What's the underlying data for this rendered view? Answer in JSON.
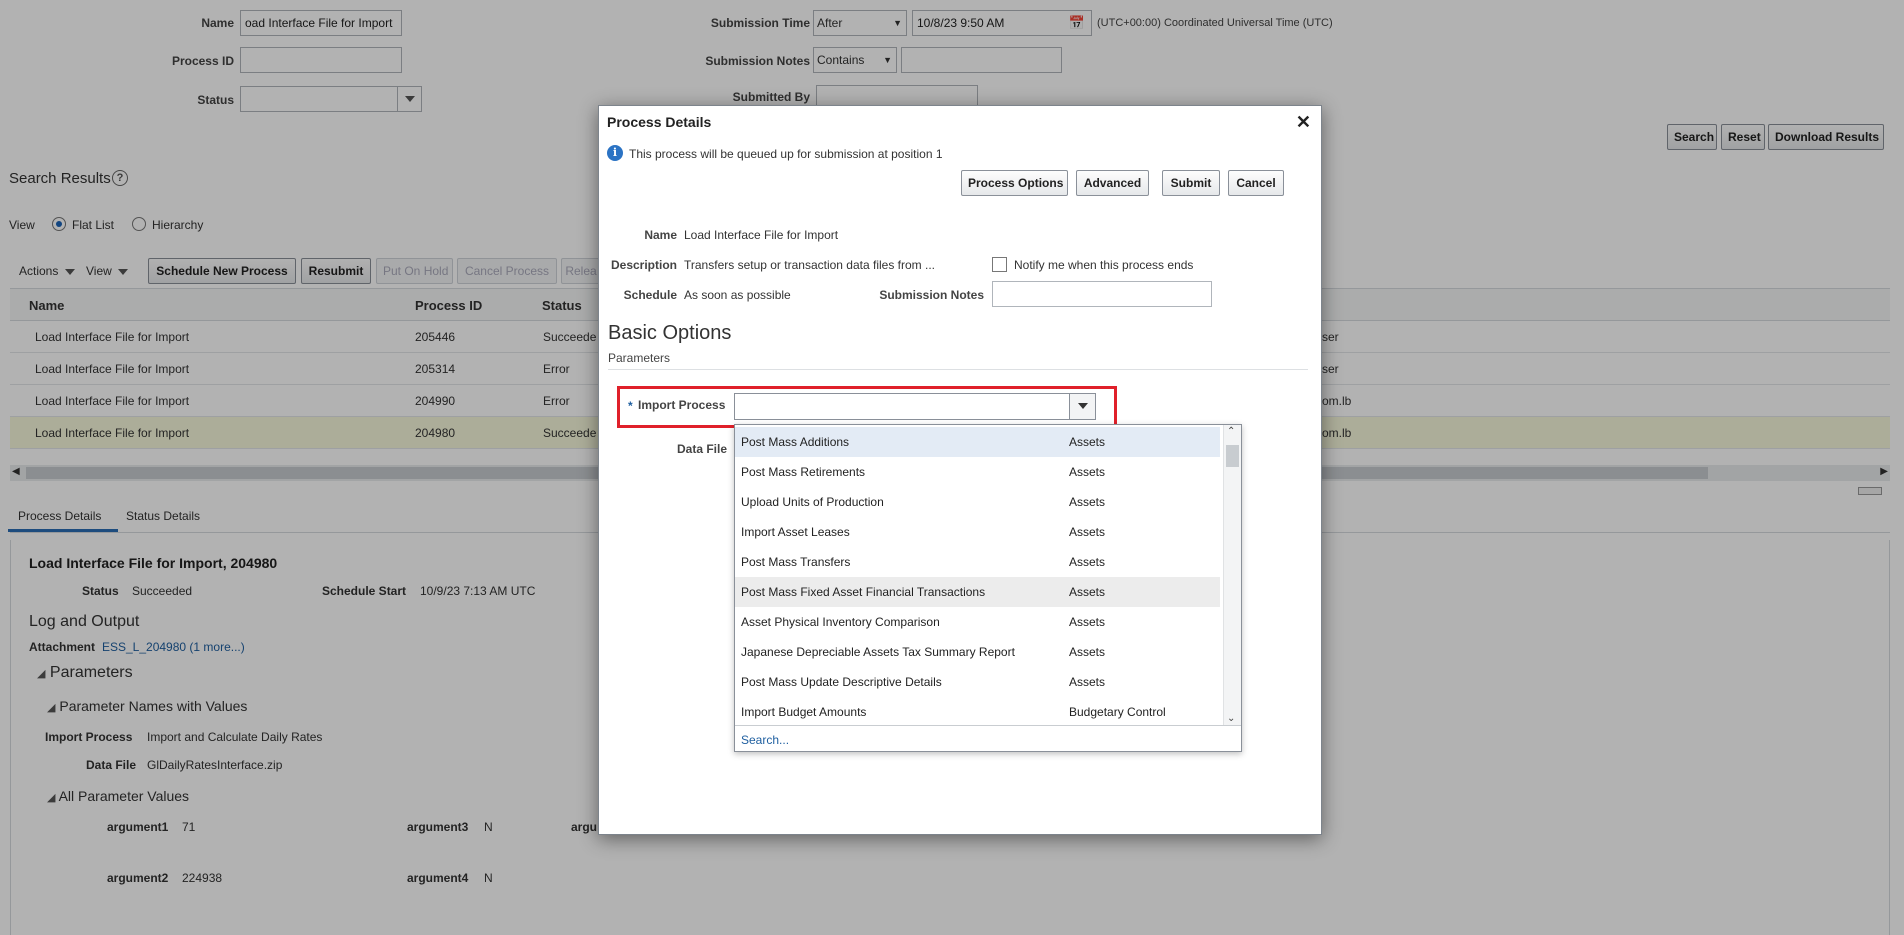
{
  "search": {
    "name_label": "Name",
    "name_value": "oad Interface File for Import",
    "process_id_label": "Process ID",
    "status_label": "Status",
    "submission_time_label": "Submission Time",
    "submission_time_op": "After",
    "submission_time_value": "10/8/23 9:50 AM",
    "timezone": "(UTC+00:00) Coordinated Universal Time (UTC)",
    "submission_notes_label": "Submission Notes",
    "submission_notes_op": "Contains",
    "submitted_by_label": "Submitted By",
    "search_button": "Search",
    "reset_button": "Reset",
    "download_button": "Download Results"
  },
  "results": {
    "title": "Search Results",
    "view_label": "View",
    "flat_list": "Flat List",
    "hierarchy": "Hierarchy",
    "toolbar": {
      "actions": "Actions",
      "view": "View",
      "schedule_new": "Schedule New Process",
      "resubmit": "Resubmit",
      "put_on_hold": "Put On Hold",
      "cancel_process": "Cancel Process",
      "release": "Relea"
    },
    "columns": [
      "Name",
      "Process ID",
      "Status"
    ],
    "rows": [
      {
        "name": "Load Interface File for Import",
        "id": "205446",
        "status": "Succeede",
        "tail": "ser"
      },
      {
        "name": "Load Interface File for Import",
        "id": "205314",
        "status": "Error",
        "tail": "ser"
      },
      {
        "name": "Load Interface File for Import",
        "id": "204990",
        "status": "Error",
        "tail": "om.lb"
      },
      {
        "name": "Load Interface File for Import",
        "id": "204980",
        "status": "Succeede",
        "tail": "om.lb"
      }
    ]
  },
  "details": {
    "tab_process": "Process Details",
    "tab_status": "Status Details",
    "heading": "Load Interface File for Import, 204980",
    "status_label": "Status",
    "status_value": "Succeeded",
    "schedule_start_label": "Schedule Start",
    "schedule_start_value": "10/9/23 7:13 AM UTC",
    "log_output": "Log and Output",
    "attachment_label": "Attachment",
    "attachment_value": "ESS_L_204980 (1 more...)",
    "parameters": "Parameters",
    "param_names": "Parameter Names with Values",
    "import_process_label": "Import Process",
    "import_process_value": "Import and Calculate Daily Rates",
    "data_file_label": "Data File",
    "data_file_value": "GlDailyRatesInterface.zip",
    "all_params": "All Parameter Values",
    "arg1_label": "argument1",
    "arg1_value": "71",
    "arg2_label": "argument2",
    "arg2_value": "224938",
    "arg3_label": "argument3",
    "arg3_value": "N",
    "arg4_label": "argument4",
    "arg4_value": "N",
    "arg_cut": "argu"
  },
  "modal": {
    "title": "Process Details",
    "info": "This process will be queued up for submission at position 1",
    "btn_options": "Process Options",
    "btn_advanced": "Advanced",
    "btn_submit": "Submit",
    "btn_cancel": "Cancel",
    "name_label": "Name",
    "name_value": "Load Interface File for Import",
    "desc_label": "Description",
    "desc_value": "Transfers setup or transaction data files from ...",
    "notify_label": "Notify me when this process ends",
    "schedule_label": "Schedule",
    "schedule_value": "As soon as possible",
    "sub_notes_label": "Submission Notes",
    "basic_options": "Basic Options",
    "parameters": "Parameters",
    "required_mark": "*",
    "import_process_label": "Import Process",
    "data_file_label": "Data File",
    "dropdown": [
      {
        "name": "Post Mass Additions",
        "cat": "Assets"
      },
      {
        "name": "Post Mass Retirements",
        "cat": "Assets"
      },
      {
        "name": "Upload Units of Production",
        "cat": "Assets"
      },
      {
        "name": "Import Asset Leases",
        "cat": "Assets"
      },
      {
        "name": "Post Mass Transfers",
        "cat": "Assets"
      },
      {
        "name": "Post Mass Fixed Asset Financial Transactions",
        "cat": "Assets"
      },
      {
        "name": "Asset Physical Inventory Comparison",
        "cat": "Assets"
      },
      {
        "name": "Japanese Depreciable Assets Tax Summary Report",
        "cat": "Assets"
      },
      {
        "name": "Post Mass Update Descriptive Details",
        "cat": "Assets"
      },
      {
        "name": "Import Budget Amounts",
        "cat": "Budgetary Control"
      }
    ],
    "dropdown_search": "Search..."
  }
}
